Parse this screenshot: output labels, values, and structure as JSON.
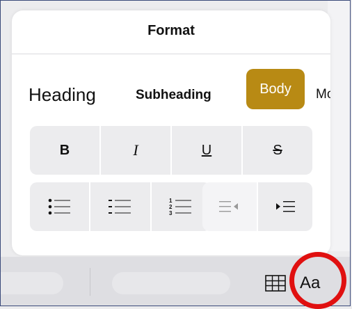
{
  "panel": {
    "title": "Format"
  },
  "styles": {
    "heading": "Heading",
    "subheading": "Subheading",
    "body": "Body",
    "more": "Mo",
    "selected_color": "#b88a14"
  },
  "format_buttons": {
    "bold": "B",
    "italic": "I",
    "underline": "U",
    "strikethrough": "S"
  },
  "list_buttons": {
    "icons": [
      "bullet-list-icon",
      "dash-list-icon",
      "numbered-list-icon"
    ],
    "numbered_digits": [
      "1",
      "2",
      "3"
    ]
  },
  "indent_buttons": {
    "icons": [
      "decrease-indent-icon",
      "increase-indent-icon"
    ]
  },
  "toolbar": {
    "text_style_label": "Aa",
    "icons": [
      "table-icon"
    ]
  },
  "annotation": {
    "ring_color": "#e01010"
  }
}
